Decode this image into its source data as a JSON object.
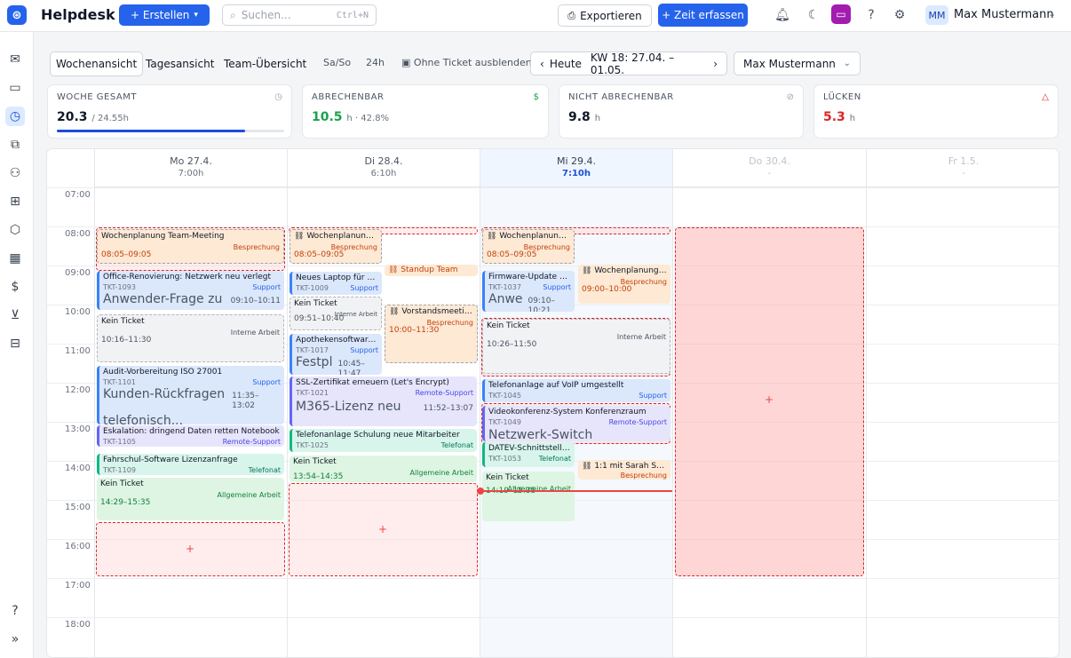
{
  "header": {
    "logo_glyph": "⊛",
    "app_name": "Helpdesk",
    "create_label": "+ Erstellen",
    "search_placeholder": "Suchen...",
    "search_shortcut": "Ctrl+N",
    "export_label": "Exportieren",
    "time_label": "+ Zeit erfassen",
    "user_initials": "MM",
    "user_name": "Max Mustermann"
  },
  "toolbar": {
    "views": [
      "Wochenansicht",
      "Tagesansicht",
      "Team-Übersicht"
    ],
    "weekend_label": "Sa/So",
    "hours_label": "24h",
    "hide_no_ticket_label": "Ohne Ticket ausblenden",
    "today_label": "Heute",
    "week_label": "KW 18: 27.04. – 01.05.",
    "user_select": "Max Mustermann"
  },
  "stats": [
    {
      "label": "WOCHE GESAMT",
      "value": "20.3",
      "sub": "/ 24.55h",
      "progress": 0.83,
      "color": "#111827"
    },
    {
      "label": "ABRECHENBAR",
      "value": "10.5",
      "sub": "h · 42.8%",
      "color": "#16a34a"
    },
    {
      "label": "NICHT ABRECHENBAR",
      "value": "9.8",
      "sub": "h",
      "color": "#111827"
    },
    {
      "label": "LÜCKEN",
      "value": "5.3",
      "sub": "h",
      "color": "#dc2626"
    }
  ],
  "days": [
    {
      "date": "Mo 27.4.",
      "hours": "7:00h"
    },
    {
      "date": "Di 28.4.",
      "hours": "6:10h"
    },
    {
      "date": "Mi 29.4.",
      "hours": "7:10h"
    },
    {
      "date": "Do 30.4.",
      "hours": "-"
    },
    {
      "date": "Fr 1.5.",
      "hours": "-"
    }
  ],
  "hours": [
    "07:00",
    "08:00",
    "09:00",
    "10:00",
    "11:00",
    "12:00",
    "13:00",
    "14:00",
    "15:00",
    "16:00",
    "17:00",
    "18:00"
  ],
  "events": {
    "e1": {
      "title": "Wochenplanung Team-Meeting",
      "cat": "Besprechung",
      "time": "08:05–09:05"
    },
    "e2": {
      "title": "Office-Renovierung: Netzwerk neu verlegt",
      "id": "TKT-1093",
      "cat": "Support",
      "big": "Anwender-Frage zu",
      "time": "09:10–10:11"
    },
    "e3": {
      "title": "Kein Ticket",
      "cat": "Interne Arbeit",
      "time": "10:16–11:30"
    },
    "e4": {
      "title": "Audit-Vorbereitung ISO 27001",
      "id": "TKT-1101",
      "cat": "Support",
      "big": "Kunden-Rückfragen",
      "big2": "telefonisch...",
      "time": "11:35–13:02"
    },
    "e5": {
      "title": "Eskalation: dringend Daten retten Notebook",
      "id": "TKT-1105",
      "cat": "Remote-Support"
    },
    "e6": {
      "title": "Fahrschul-Software Lizenzanfrage",
      "id": "TKT-1109",
      "cat": "Telefonat"
    },
    "e7": {
      "title": "Kein Ticket",
      "cat": "Allgemeine Arbeit",
      "time": "14:29–15:35"
    },
    "e8": {
      "title": "Wochenplanung T...",
      "cat": "Besprechung",
      "time": "08:05–09:05"
    },
    "e9": {
      "title": "Standup Team"
    },
    "e10": {
      "title": "Neues Laptop für Auß...",
      "id": "TKT-1009",
      "cat": "Support"
    },
    "e11": {
      "title": "Kein Ticket",
      "cat": "Interne Arbeit",
      "time": "09:51–10:40"
    },
    "e12": {
      "title": "Vorstandsmeeting...",
      "cat": "Besprechung",
      "time": "10:00–11:30"
    },
    "e13": {
      "title": "Apothekensoftware L...",
      "id": "TKT-1017",
      "cat": "Support",
      "big": "Festpl",
      "time": "10:45–11:47"
    },
    "e14": {
      "title": "SSL-Zertifikat erneuern (Let's Encrypt)",
      "id": "TKT-1021",
      "cat": "Remote-Support",
      "big": "M365-Lizenz neu",
      "time": "11:52–13:07"
    },
    "e15": {
      "title": "Telefonanlage Schulung neue Mitarbeiter",
      "id": "TKT-1025",
      "cat": "Telefonat"
    },
    "e16": {
      "title": "Kein Ticket",
      "cat": "Allgemeine Arbeit",
      "time": "13:54–14:35"
    },
    "e17": {
      "title": "Wochenplanung T...",
      "cat": "Besprechung",
      "time": "08:05–09:05"
    },
    "e18": {
      "title": "Firmware-Update auf ...",
      "id": "TKT-1037",
      "cat": "Support",
      "big": "Anwe",
      "time": "09:10–10:21"
    },
    "e19": {
      "title": "Wochenplanung ...",
      "cat": "Besprechung",
      "time": "09:00–10:00"
    },
    "e20": {
      "title": "Kein Ticket",
      "cat": "Interne Arbeit",
      "time": "10:26–11:50"
    },
    "e21": {
      "title": "Telefonanlage auf VoIP umgestellt",
      "id": "TKT-1045",
      "cat": "Support"
    },
    "e22": {
      "title": "Videokonferenz-System Konferenzraum",
      "id": "TKT-1049",
      "cat": "Remote-Support",
      "big": "Netzwerk-Switch"
    },
    "e23": {
      "title": "DATEV-Schnittstelle ei...",
      "id": "TKT-1053",
      "cat": "Telefonat"
    },
    "e24": {
      "title": "1:1 mit Sarah Sch...",
      "cat": "Besprechung"
    },
    "e25": {
      "title": "Kein Ticket",
      "cat": "Allgemeine Arbeit",
      "time": "14:19–15:35"
    }
  },
  "add_glyph": "+"
}
